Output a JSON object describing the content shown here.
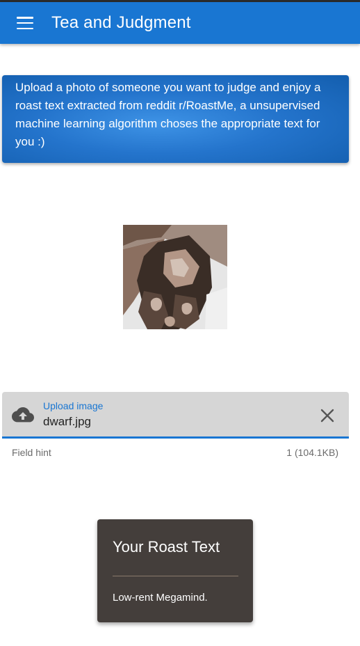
{
  "app_bar": {
    "title": "Tea and Judgment",
    "menu_icon": "hamburger-menu-icon"
  },
  "intro": {
    "text": "Upload a photo of someone you want to judge and enjoy a roast text extracted from reddit r/RoastMe, a unsupervised machine learning algorithm choses the appropriate text for you :)"
  },
  "preview": {
    "alt": "uploaded photo preview"
  },
  "upload_field": {
    "label": "Upload image",
    "value": "dwarf.jpg",
    "hint": "Field hint",
    "counter": "1 (104.1KB)",
    "prepend_icon": "cloud-upload-icon",
    "clear_icon": "close-icon"
  },
  "roast_card": {
    "title": "Your Roast Text",
    "text": "Low-rent Megamind."
  },
  "colors": {
    "primary": "#1976d2",
    "card_dark": "#443e3b"
  }
}
